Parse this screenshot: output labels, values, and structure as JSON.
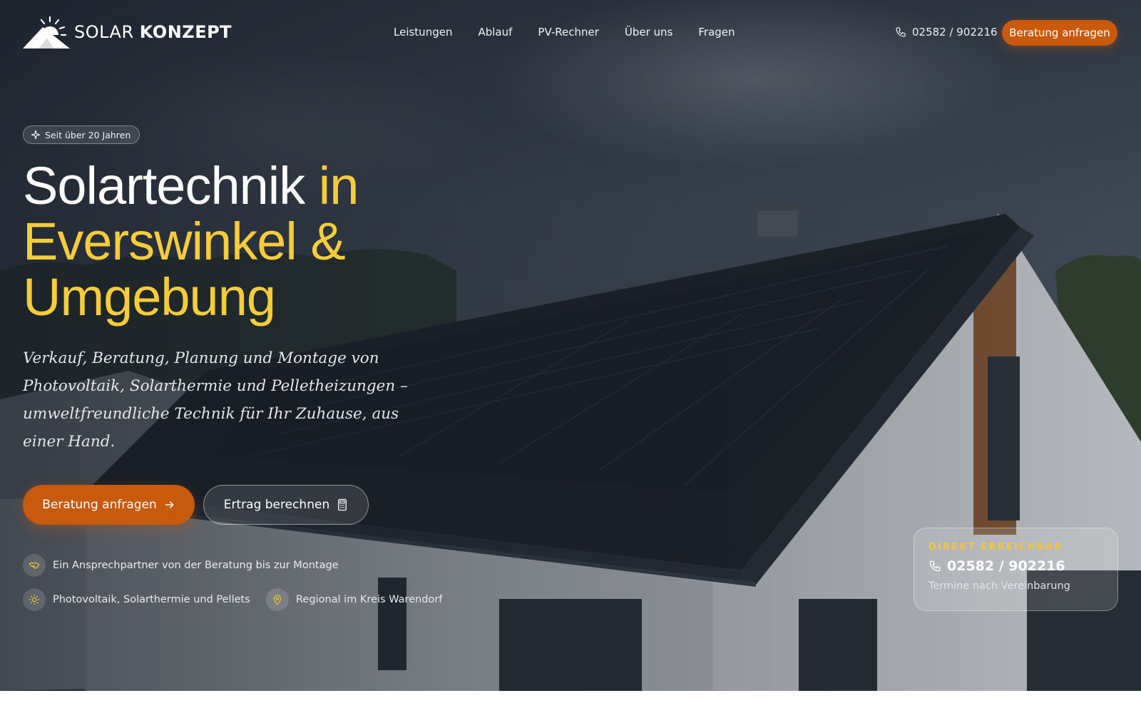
{
  "brand": {
    "name_light": "SOLAR",
    "name_bold": "KONZEPT",
    "logo_icon": "sun-roof-logo"
  },
  "nav": {
    "items": [
      {
        "label": "Leistungen"
      },
      {
        "label": "Ablauf"
      },
      {
        "label": "PV-Rechner"
      },
      {
        "label": "Über uns"
      },
      {
        "label": "Fragen"
      }
    ]
  },
  "header": {
    "phone": "02582 / 902216",
    "phone_icon": "phone-icon",
    "cta_label": "Beratung anfragen"
  },
  "hero": {
    "badge": "Seit über 20 Jahren",
    "badge_icon": "sparkle-icon",
    "headline_white": "Solartechnik",
    "headline_yellow": "in Everswinkel & Umgebung",
    "subtitle": "Verkauf, Beratung, Planung und Montage von Photovoltaik, Solarthermie und Pelletheizungen – umweltfreundliche Technik für Ihr Zuhause, aus einer Hand.",
    "primary_button": "Beratung anfragen",
    "secondary_button": "Ertrag berechnen",
    "features": [
      {
        "icon": "handshake-icon",
        "text": "Ein Ansprechpartner von der Beratung bis zur Montage"
      },
      {
        "icon": "sun-icon",
        "text": "Photovoltaik, Solarthermie und Pellets"
      },
      {
        "icon": "map-pin-icon",
        "text": "Regional im Kreis Warendorf"
      }
    ]
  },
  "contact_card": {
    "label": "DIREKT ERREICHBAR",
    "phone": "02582 / 902216",
    "note": "Termine nach Vereinbarung"
  },
  "colors": {
    "accent_orange": "#c85a0d",
    "headline_yellow": "#f7cc3a",
    "card_label_yellow": "#f4c53a"
  }
}
